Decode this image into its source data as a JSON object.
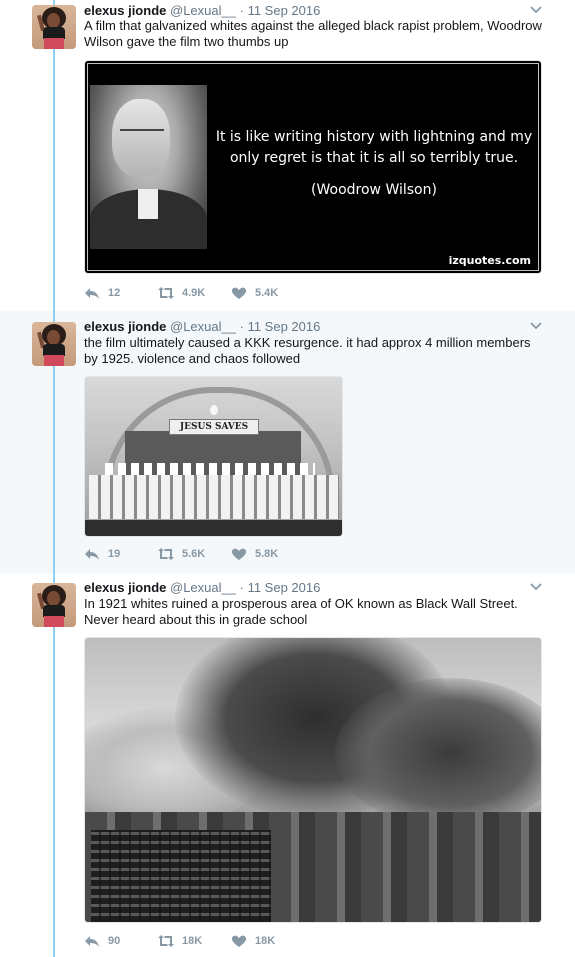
{
  "thread": [
    {
      "author_name": "elexus jionde",
      "handle": "@Lexual__",
      "separator": "·",
      "date": "11 Sep 2016",
      "text": "A film that galvanized whites against the alleged black rapist problem, Woodrow Wilson gave the film two thumbs up",
      "media": {
        "quote": "It is like writing history with lightning and my only regret is that it is all so terribly true.",
        "author": "(Woodrow Wilson)",
        "watermark": "izquotes.com"
      },
      "stats": {
        "replies": "12",
        "retweets": "4.9K",
        "likes": "5.4K"
      }
    },
    {
      "author_name": "elexus jionde",
      "handle": "@Lexual__",
      "separator": "·",
      "date": "11 Sep 2016",
      "text": "the film ultimately caused a KKK resurgence. it had approx 4 million members by 1925. violence and chaos followed",
      "media": {
        "banner_text": "JESUS SAVES"
      },
      "stats": {
        "replies": "19",
        "retweets": "5.6K",
        "likes": "5.8K"
      }
    },
    {
      "author_name": "elexus jionde",
      "handle": "@Lexual__",
      "separator": "·",
      "date": "11 Sep 2016",
      "text": "In 1921 whites ruined a prosperous area of OK known as Black Wall Street. Never heard about this in grade school",
      "media": {},
      "stats": {
        "replies": "90",
        "retweets": "18K",
        "likes": "18K"
      }
    }
  ],
  "icons": {
    "reply": "reply-icon",
    "retweet": "retweet-icon",
    "like": "heart-icon",
    "more": "chevron-down-icon"
  },
  "colors": {
    "thread_line": "#8dd0f0",
    "secondary_text": "#657786",
    "action_gray": "#8899a6",
    "highlight_bg": "#f5f8fa"
  }
}
